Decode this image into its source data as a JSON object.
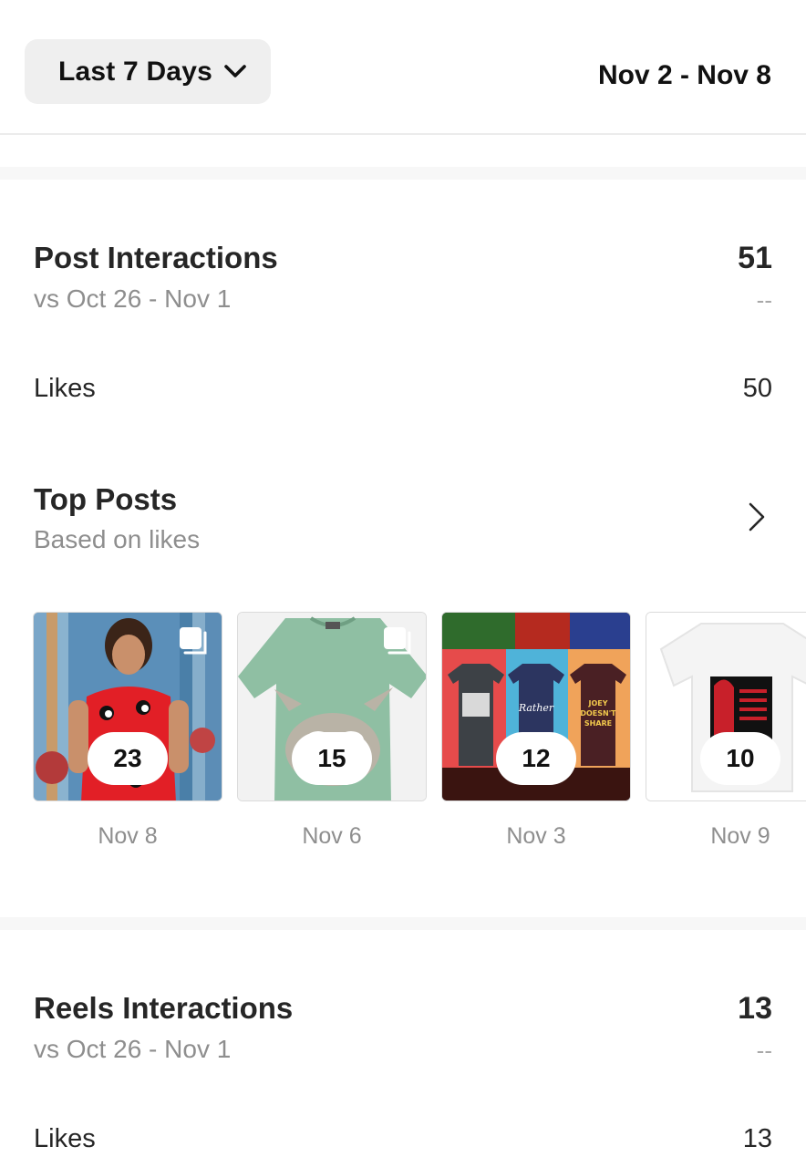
{
  "header": {
    "range_label": "Last 7 Days",
    "date_range": "Nov 2 - Nov 8"
  },
  "post_interactions": {
    "title": "Post Interactions",
    "subtitle": "vs Oct 26 - Nov 1",
    "value": "51",
    "delta": "--",
    "rows": [
      {
        "label": "Likes",
        "value": "50"
      }
    ]
  },
  "top_posts": {
    "title": "Top Posts",
    "subtitle": "Based on likes",
    "posts": [
      {
        "count": "23",
        "date": "Nov 8",
        "multi": true
      },
      {
        "count": "15",
        "date": "Nov 6",
        "multi": true
      },
      {
        "count": "12",
        "date": "Nov 3",
        "multi": false
      },
      {
        "count": "10",
        "date": "Nov 9",
        "multi": false
      }
    ]
  },
  "reels_interactions": {
    "title": "Reels Interactions",
    "subtitle": "vs Oct 26 - Nov 1",
    "value": "13",
    "delta": "--",
    "rows": [
      {
        "label": "Likes",
        "value": "13"
      }
    ]
  },
  "icons": {
    "range_dropdown": "chevron-down-icon",
    "top_posts_arrow": "chevron-right-icon",
    "carousel_marker": "carousel-icon"
  },
  "colors": {
    "primary_text": "#262626",
    "secondary_text": "#8e8e8e",
    "button_bg": "#efefef",
    "separator": "#f7f7f7"
  }
}
